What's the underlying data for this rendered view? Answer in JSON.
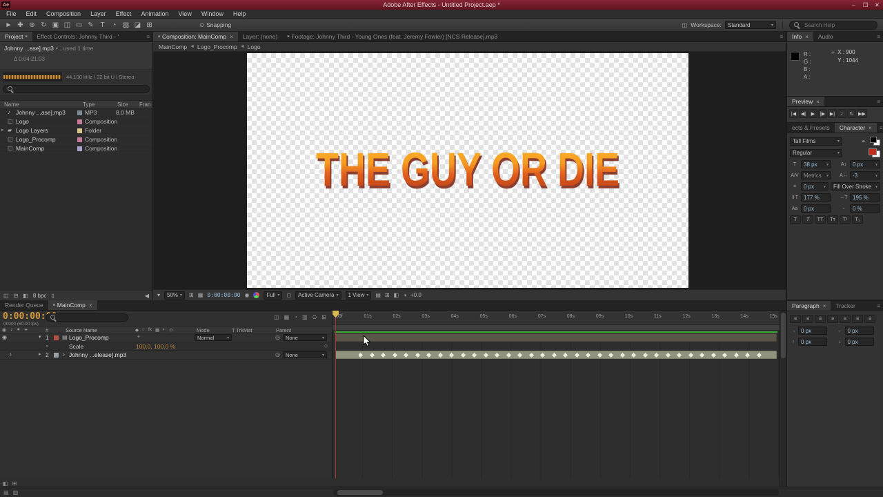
{
  "ui": {
    "panel_menu": "≡",
    "tab_square": "■",
    "close_glyph": "×",
    "dropdown_arrow": "▾",
    "crumb_sep": "◄"
  },
  "colors": {
    "titlebar": "#6e1b26",
    "preview_green": "#3da93d",
    "timecode_orange": "#d69a3d",
    "value_blue": "#9fc1da",
    "text_gradient_top": "#fdb92e",
    "text_gradient_bottom": "#aa3414"
  },
  "titlebar": {
    "app_icon": "Ae",
    "title": "Adobe After Effects - Untitled Project.aep *",
    "min": "–",
    "max": "❐",
    "close": "✕"
  },
  "menubar": {
    "items": [
      "File",
      "Edit",
      "Composition",
      "Layer",
      "Effect",
      "Animation",
      "View",
      "Window",
      "Help"
    ]
  },
  "toolbar": {
    "tools": [
      {
        "name": "selection-tool-icon",
        "glyph": "►"
      },
      {
        "name": "hand-tool-icon",
        "glyph": "✚"
      },
      {
        "name": "zoom-tool-icon",
        "glyph": "⊕"
      },
      {
        "name": "rotation-tool-icon",
        "glyph": "↻"
      },
      {
        "name": "camera-tool-icon",
        "glyph": "▣"
      },
      {
        "name": "pan-behind-tool-icon",
        "glyph": "◫"
      },
      {
        "name": "shape-tool-icon",
        "glyph": "▭"
      },
      {
        "name": "pen-tool-icon",
        "glyph": "✎"
      },
      {
        "name": "type-tool-icon",
        "glyph": "T"
      },
      {
        "name": "brush-tool-icon",
        "glyph": "◔"
      },
      {
        "name": "clone-stamp-tool-icon",
        "glyph": "▨"
      },
      {
        "name": "eraser-tool-icon",
        "glyph": "◪"
      },
      {
        "name": "puppet-pin-tool-icon",
        "glyph": "⊞"
      }
    ],
    "snapping_icon": "⊙",
    "snapping": "Snapping",
    "workspace_icon": "◫",
    "workspace_label": "Workspace:",
    "workspace_value": "Standard",
    "search_placeholder": "Search Help",
    "search_value": ""
  },
  "project": {
    "tab_project": "Project",
    "tab_effect_controls": "Effect Controls: Johnny Third - Yo",
    "item_name": "Johnny ...ase].mp3",
    "item_usage": ", used 1 time",
    "item_delta": "Δ 0:04:21:03",
    "item_format": "44.100 kHz / 32 bit U / Stereo",
    "search_value": "",
    "columns": [
      "Name",
      "Type",
      "Size",
      "Fran"
    ],
    "rows": [
      {
        "name": "Johnny ...ase].mp3",
        "icon": "♪",
        "expander": "",
        "type": "MP3",
        "size": "8.0 MB",
        "chip": "#7f8a95"
      },
      {
        "name": "Logo",
        "icon": "◫",
        "expander": "",
        "type": "Composition",
        "size": "",
        "chip": "#c77b9b"
      },
      {
        "name": "Logo Layers",
        "icon": "▰",
        "expander": "▸",
        "type": "Folder",
        "size": "",
        "chip": "#d6c58d"
      },
      {
        "name": "Logo_Procomp",
        "icon": "◫",
        "expander": "",
        "type": "Composition",
        "size": "",
        "chip": "#c77b9b"
      },
      {
        "name": "MainComp",
        "icon": "◫",
        "expander": "",
        "type": "Composition",
        "size": "",
        "chip": "#a9a2cc"
      }
    ],
    "footer_icons": [
      {
        "name": "interpret-footage-icon",
        "glyph": "◫"
      },
      {
        "name": "new-folder-icon",
        "glyph": "⊟"
      },
      {
        "name": "new-composition-icon",
        "glyph": "◧"
      }
    ],
    "bit_depth": "8 bpc",
    "trash_glyph": "▯",
    "scroll_glyph": "◀"
  },
  "comp": {
    "tab_composition": "Composition: MainComp",
    "tab_layer": "Layer: (none)",
    "tab_footage": "Footage: Johnny Third - Young Ones (feat. Jeremy Fowler) [NCS Release].mp3",
    "breadcrumb": [
      {
        "label": "MainComp"
      },
      {
        "label": "Logo_Procomp"
      },
      {
        "label": "Logo"
      }
    ],
    "canvas_text": "THE GUY OR DIE",
    "zoom": "50%",
    "timecode": "0:00:00:00",
    "resolution": "Full",
    "camera": "Active Camera",
    "view_layout": "1 View",
    "exposure": "+0.0",
    "icons": {
      "always_preview": "▾",
      "grid": "⊞",
      "rulers": "▦",
      "snapshot": "◉",
      "roi": "◻",
      "aux1": "▤",
      "aux2": "⊞",
      "aux3": "◧",
      "exposure_icon": "◑"
    }
  },
  "info": {
    "tab_info": "Info",
    "tab_audio": "Audio",
    "channels": [
      "R :",
      "G :",
      "B :",
      "A :"
    ],
    "crosshair": "+",
    "x": "X : 900",
    "y": "Y : 1044"
  },
  "preview": {
    "tab": "Preview",
    "buttons": [
      {
        "name": "first-frame-button",
        "glyph": "|◀"
      },
      {
        "name": "prev-frame-button",
        "glyph": "◀|"
      },
      {
        "name": "play-button",
        "glyph": "▶"
      },
      {
        "name": "next-frame-button",
        "glyph": "|▶"
      },
      {
        "name": "last-frame-button",
        "glyph": "▶|"
      },
      {
        "name": "audio-toggle-button",
        "glyph": "♪"
      },
      {
        "name": "loop-button",
        "glyph": "↻"
      },
      {
        "name": "ram-preview-button",
        "glyph": "▶▶"
      }
    ]
  },
  "character": {
    "tab_effects": "ects & Presets",
    "tab_character": "Character",
    "font_family": "Tall Films",
    "font_style": "Regular",
    "font_size": "38 px",
    "leading": "0 px",
    "kerning": "Metrics",
    "tracking": "-3",
    "stroke_width": "0 px",
    "stroke_style": "Fill Over Stroke",
    "vertical_scale": "177 %",
    "horizontal_scale": "195 %",
    "baseline_shift": "0 px",
    "tsume": "0 %",
    "icons": {
      "eyedropper": "✒",
      "size": "T",
      "leading": "A↕",
      "kerning": "A/V",
      "tracking": "A↔",
      "stroke": "≡",
      "vscale": "⇕T",
      "hscale": "⇔T",
      "baseline": "Aa",
      "tsume": "▫"
    },
    "style_buttons": [
      {
        "name": "faux-bold-button",
        "glyph": "T"
      },
      {
        "name": "faux-italic-button",
        "glyph": "T"
      },
      {
        "name": "all-caps-button",
        "glyph": "TT"
      },
      {
        "name": "small-caps-button",
        "glyph": "Tᴛ"
      },
      {
        "name": "superscript-button",
        "glyph": "T¹"
      },
      {
        "name": "subscript-button",
        "glyph": "T₁"
      }
    ]
  },
  "paragraph": {
    "tab_paragraph": "Paragraph",
    "tab_tracker": "Tracker",
    "align_buttons": [
      {
        "name": "align-left-button",
        "glyph": "≡"
      },
      {
        "name": "align-center-button",
        "glyph": "≡"
      },
      {
        "name": "align-right-button",
        "glyph": "≡"
      },
      {
        "name": "justify-last-left-button",
        "glyph": "≡"
      },
      {
        "name": "justify-last-center-button",
        "glyph": "≡"
      },
      {
        "name": "justify-last-right-button",
        "glyph": "≡"
      },
      {
        "name": "justify-all-button",
        "glyph": "≡"
      }
    ],
    "fields": [
      {
        "name": "indent-left-field",
        "icon": "→",
        "value": "0 px"
      },
      {
        "name": "indent-right-field",
        "icon": "←",
        "value": "0 px"
      },
      {
        "name": "space-before-field",
        "icon": "↑",
        "value": "0 px"
      },
      {
        "name": "space-after-field",
        "icon": "↓",
        "value": "0 px"
      }
    ]
  },
  "timeline": {
    "tab_render_queue": "Render Queue",
    "tab_maincomp": "MainComp",
    "timecode": "0:00:00:00",
    "frame_info": "00000 (60.00 fps)",
    "search_value": "",
    "view_icons": [
      {
        "name": "comp-mini-flowchart-icon",
        "glyph": "◫"
      },
      {
        "name": "draft-3d-icon",
        "glyph": "▦"
      },
      {
        "name": "hide-shy-layers-icon",
        "glyph": "◔"
      },
      {
        "name": "frame-blending-icon",
        "glyph": "▥"
      },
      {
        "name": "motion-blur-icon",
        "glyph": "⊙"
      },
      {
        "name": "graph-editor-icon",
        "glyph": "⊞"
      }
    ],
    "avcol_icons": [
      {
        "name": "video-column-icon",
        "glyph": "◉"
      },
      {
        "name": "audio-column-icon",
        "glyph": "♪"
      },
      {
        "name": "solo-column-icon",
        "glyph": "●"
      },
      {
        "name": "lock-column-icon",
        "glyph": "✦"
      }
    ],
    "col_num": "#",
    "col_source_name": "Source Name",
    "switch_icons": [
      "◆",
      "○",
      "fx",
      "▦",
      "◐",
      "⊙"
    ],
    "col_mode": "Mode",
    "col_trkmat": "T TrkMat",
    "col_parent": "Parent",
    "icons": {
      "eye": "◉",
      "speaker": "♪",
      "twirl_open": "▾",
      "twirl_closed": "▸",
      "stopwatch": "◔",
      "pickwhip": "◎",
      "kf_nav": "◇",
      "switch_dot": "✦",
      "layer_icon": "▤",
      "audio_icon": "♪"
    },
    "layer1_num": "1",
    "layer1_name": "Logo_Procomp",
    "layer1_chip": "#b5524a",
    "layer1_mode": "Normal",
    "layer1_parent": "None",
    "prop_name": "Scale",
    "prop_value": "100.0, 100.0 %",
    "layer2_num": "2",
    "layer2_name": "Johnny ...elease].mp3",
    "layer2_chip": "#9aa1a8",
    "layer2_parent": "None",
    "ruler_labels": [
      ":00f",
      "01s",
      "02s",
      "03s",
      "04s",
      "05s",
      "06s",
      "07s",
      "08s",
      "09s",
      "10s",
      "11s",
      "12s",
      "13s",
      "14s",
      "15s"
    ],
    "audio_keyframes": 36,
    "footer_icons": [
      {
        "name": "expand-layer-switches-icon",
        "glyph": "◧"
      },
      {
        "name": "expand-in-out-icon",
        "glyph": "⊞"
      }
    ]
  },
  "bottombar": {
    "icons": [
      {
        "name": "toggle-panel-a-icon",
        "glyph": "▤"
      },
      {
        "name": "toggle-panel-b-icon",
        "glyph": "▥"
      }
    ]
  }
}
